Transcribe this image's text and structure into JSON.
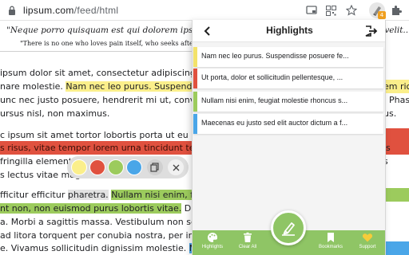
{
  "browser": {
    "url_host": "lipsum.com",
    "url_path": "/feed/html",
    "extension_badge": "4"
  },
  "article": {
    "quote": "\"Neque porro quisquam est qui dolorem ipsum quia dolor sit amet, consectetur, adipisci velit...\"",
    "quote_translation": "\"There is no one who loves pain itself, who seeks after it and wants to have it, simply because it is pain...\"",
    "p1_l1": "ipsum dolor sit amet, consectetur adipiscing e",
    "p1_l2_a": "nare molestie. ",
    "p1_l2_b": "Nam nec leo purus. Suspendi",
    "p1_l3": "unc nec justo posuere, hendrerit mi ut, conval",
    "p1_l4": "ursus nisl, non maximus.",
    "p2_l1": "c ipsum sit amet tortor lobortis porta ut eu",
    "p2_l2": "s risus, vitae tempor lorem urna tincidunt tel",
    "p2_l3": "fringilla elementum",
    "p2_l4": "s lectus vitae magna",
    "p3_l1_a": "fficitur efficitur ",
    "p3_l1_b": "pharetra.",
    "p3_l1_c": " ",
    "p3_l1_d": "Nullam nisi enim, fe",
    "p3_l2_a": "nt non, non euismod purus lobortis vitae.",
    "p3_l2_b": " Du",
    "p3_l3": "a. Morbi a sagittis massa. Vestibulum non se",
    "p3_l4": "ad litora torquent per conubia nostra, per in",
    "p3_l5_a": "e. Vivamus sollicitudin dignissim molestie. ",
    "p3_l5_b": "Ma",
    "r1": "em ric",
    "r2": ". Phase",
    "r3": "us.",
    "r4": "is",
    "r5": "s"
  },
  "palette": {
    "colors": [
      "#fbef8b",
      "#e0513f",
      "#9ccb5d",
      "#4aa6e8"
    ],
    "copy_icon": "copy-icon",
    "close_icon": "close-icon"
  },
  "panel": {
    "title": "Highlights",
    "back_icon": "chevron-left-icon",
    "exit_icon": "exit-icon",
    "items": [
      {
        "text": "Nam nec leo purus. Suspendisse posuere fe...",
        "color": "#f3e26b"
      },
      {
        "text": "Ut porta, dolor et sollicitudin pellentesque, ...",
        "color": "#e0513f"
      },
      {
        "text": "Nullam nisi enim, feugiat molestie rhoncus s...",
        "color": "#9ccb5d"
      },
      {
        "text": "Maecenas eu justo sed elit auctor dictum a f...",
        "color": "#4aa6e8"
      }
    ],
    "nav": {
      "highlights": "Highlights",
      "clear_all": "Clear All",
      "bookmarks": "Bookmarks",
      "support": "Support"
    },
    "accent": "#8fc565"
  }
}
